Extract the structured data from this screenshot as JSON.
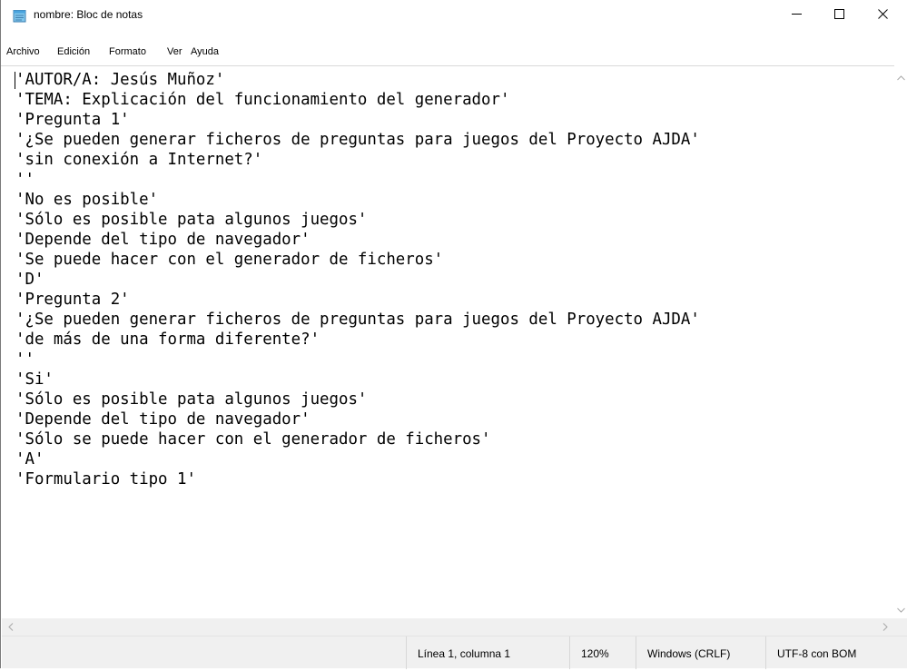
{
  "window": {
    "title": "nombre: Bloc de notas",
    "icon": "notepad-icon",
    "controls": [
      "minimize-icon",
      "maximize-icon",
      "close-icon"
    ]
  },
  "menu": {
    "items": [
      "Archivo",
      "Edición",
      "Formato",
      "Ver",
      "Ayuda"
    ]
  },
  "editor": {
    "lines": [
      "'AUTOR/A: Jesús Muñoz'",
      "'TEMA: Explicación del funcionamiento del generador'",
      "'Pregunta 1'",
      "'¿Se pueden generar ficheros de preguntas para juegos del Proyecto AJDA'",
      "'sin conexión a Internet?'",
      "''",
      "'No es posible'",
      "'Sólo es posible pata algunos juegos'",
      "'Depende del tipo de navegador'",
      "'Se puede hacer con el generador de ficheros'",
      "'D'",
      "'Pregunta 2'",
      "'¿Se pueden generar ficheros de preguntas para juegos del Proyecto AJDA'",
      "'de más de una forma diferente?'",
      "''",
      "'Si'",
      "'Sólo es posible pata algunos juegos'",
      "'Depende del tipo de navegador'",
      "'Sólo se puede hacer con el generador de ficheros'",
      "'A'",
      "'Formulario tipo 1'"
    ]
  },
  "status": {
    "position": "Línea 1, columna 1",
    "zoom": "120%",
    "line_ending": "Windows (CRLF)",
    "encoding": "UTF-8 con BOM"
  }
}
